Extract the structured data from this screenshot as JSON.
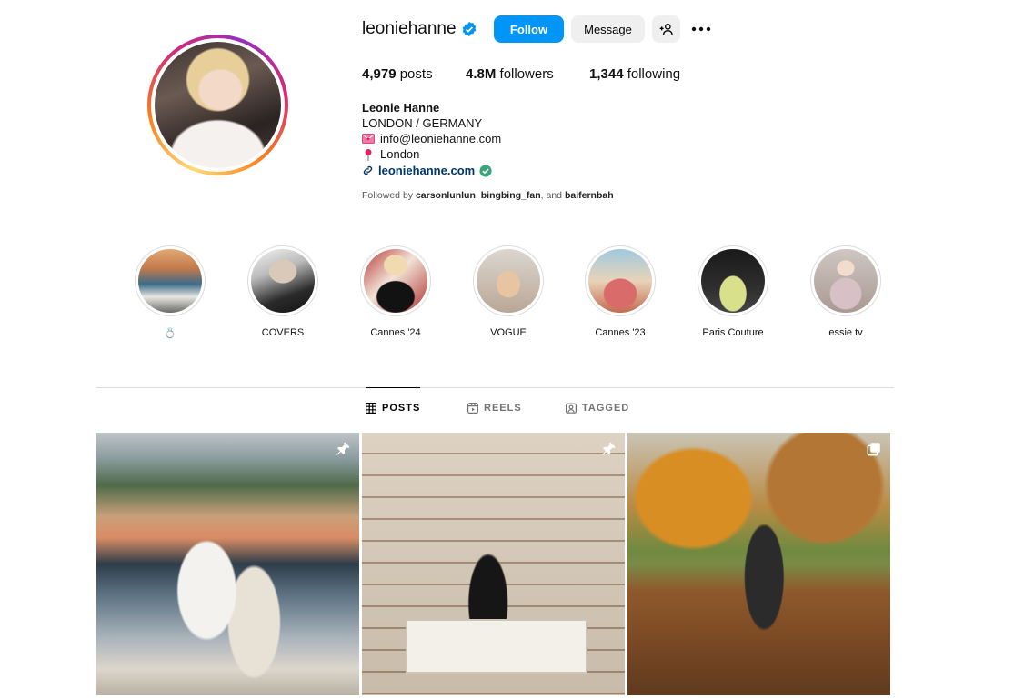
{
  "profile": {
    "username": "leoniehanne",
    "follow_label": "Follow",
    "message_label": "Message",
    "stats": {
      "posts_count": "4,979",
      "posts_label": "posts",
      "followers_count": "4.8M",
      "followers_label": "followers",
      "following_count": "1,344",
      "following_label": "following"
    },
    "bio": {
      "name": "Leonie Hanne",
      "location_line": "LONDON / GERMANY",
      "email": "info@leoniehanne.com",
      "city": "London",
      "link": "leoniehanne.com"
    },
    "followed_by": {
      "prefix": "Followed by",
      "user1": "carsonlunlun",
      "sep1": ",",
      "user2": "bingbing_fan",
      "sep2": ", and",
      "user3": "baifernbah"
    }
  },
  "highlights": [
    {
      "label": "💍"
    },
    {
      "label": "COVERS"
    },
    {
      "label": "Cannes '24"
    },
    {
      "label": "VOGUE"
    },
    {
      "label": "Cannes '23"
    },
    {
      "label": "Paris Couture"
    },
    {
      "label": "essie tv"
    }
  ],
  "tabs": [
    {
      "label": "POSTS",
      "active": true
    },
    {
      "label": "REELS",
      "active": false
    },
    {
      "label": "TAGGED",
      "active": false
    }
  ],
  "posts": [
    {
      "badge": "pin-icon"
    },
    {
      "badge": "pin-icon"
    },
    {
      "badge": "carousel-icon"
    }
  ],
  "colors": {
    "follow_button": "#0095f6",
    "secondary_button": "#efefef",
    "link": "#00376b",
    "verified": "#0095f6"
  }
}
